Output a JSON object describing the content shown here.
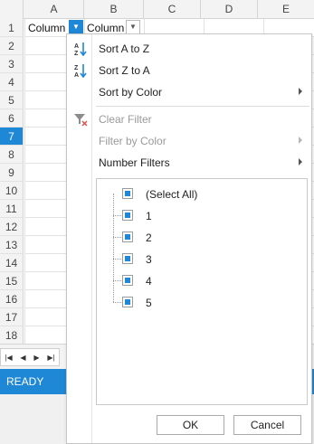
{
  "columns": [
    "A",
    "B",
    "C",
    "D",
    "E"
  ],
  "rows": [
    "1",
    "2",
    "3",
    "4",
    "5",
    "6",
    "7",
    "8",
    "9",
    "10",
    "11",
    "12",
    "13",
    "14",
    "15",
    "16",
    "17",
    "18"
  ],
  "selected_row": "7",
  "cells": {
    "A1": "Column",
    "B1": "Column"
  },
  "status": {
    "text": "READY"
  },
  "menu": {
    "sort_az": "Sort A to Z",
    "sort_za": "Sort Z to A",
    "sort_by_color": "Sort by Color",
    "clear_filter": "Clear Filter",
    "filter_by_color": "Filter by Color",
    "number_filters": "Number Filters"
  },
  "filter_values": [
    "(Select All)",
    "1",
    "2",
    "3",
    "4",
    "5"
  ],
  "buttons": {
    "ok": "OK",
    "cancel": "Cancel"
  },
  "colors": {
    "accent": "#1e87d6",
    "clear_filter_icon_red": "#e05050"
  },
  "icons": {
    "sort_az": "sort-ascending-icon",
    "sort_za": "sort-descending-icon",
    "clear_filter": "funnel-clear-icon",
    "tab_nav": [
      "first-sheet-icon",
      "prev-sheet-icon",
      "next-sheet-icon",
      "last-sheet-icon"
    ]
  }
}
